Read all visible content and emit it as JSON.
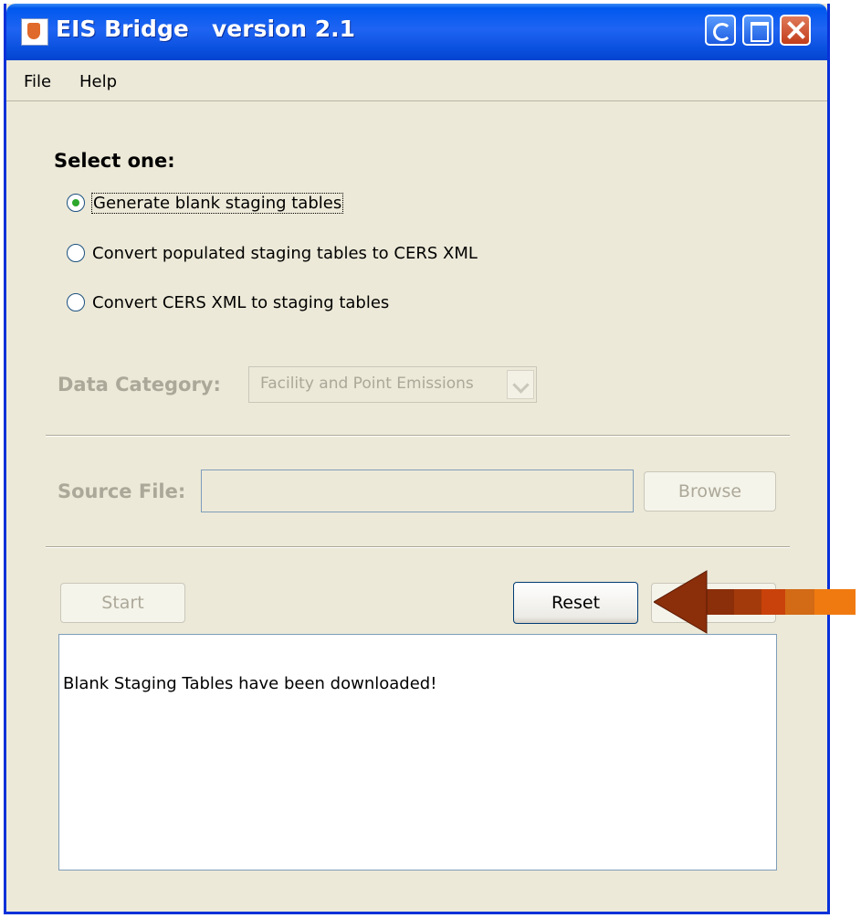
{
  "window": {
    "title": "EIS Bridge",
    "version": "version 2.1"
  },
  "menu": {
    "items": [
      {
        "label": "File"
      },
      {
        "label": "Help"
      }
    ]
  },
  "options": {
    "heading": "Select one:",
    "items": [
      {
        "label": "Generate blank staging tables",
        "selected": true
      },
      {
        "label": "Convert populated staging tables to CERS XML",
        "selected": false
      },
      {
        "label": "Convert CERS XML to staging tables",
        "selected": false
      }
    ]
  },
  "data_category": {
    "label": "Data Category:",
    "value": "Facility and Point Emissions",
    "enabled": false
  },
  "source_file": {
    "label": "Source File:",
    "value": "",
    "browse_label": "Browse",
    "enabled": false
  },
  "actions": {
    "start_label": "Start",
    "reset_label": "Reset"
  },
  "output": {
    "message": "Blank Staging Tables have been downloaded!"
  },
  "annotation": {
    "arrow_colors": [
      "#8B2E0A",
      "#A33A0B",
      "#C9420B",
      "#D26A16",
      "#F07A10"
    ]
  }
}
